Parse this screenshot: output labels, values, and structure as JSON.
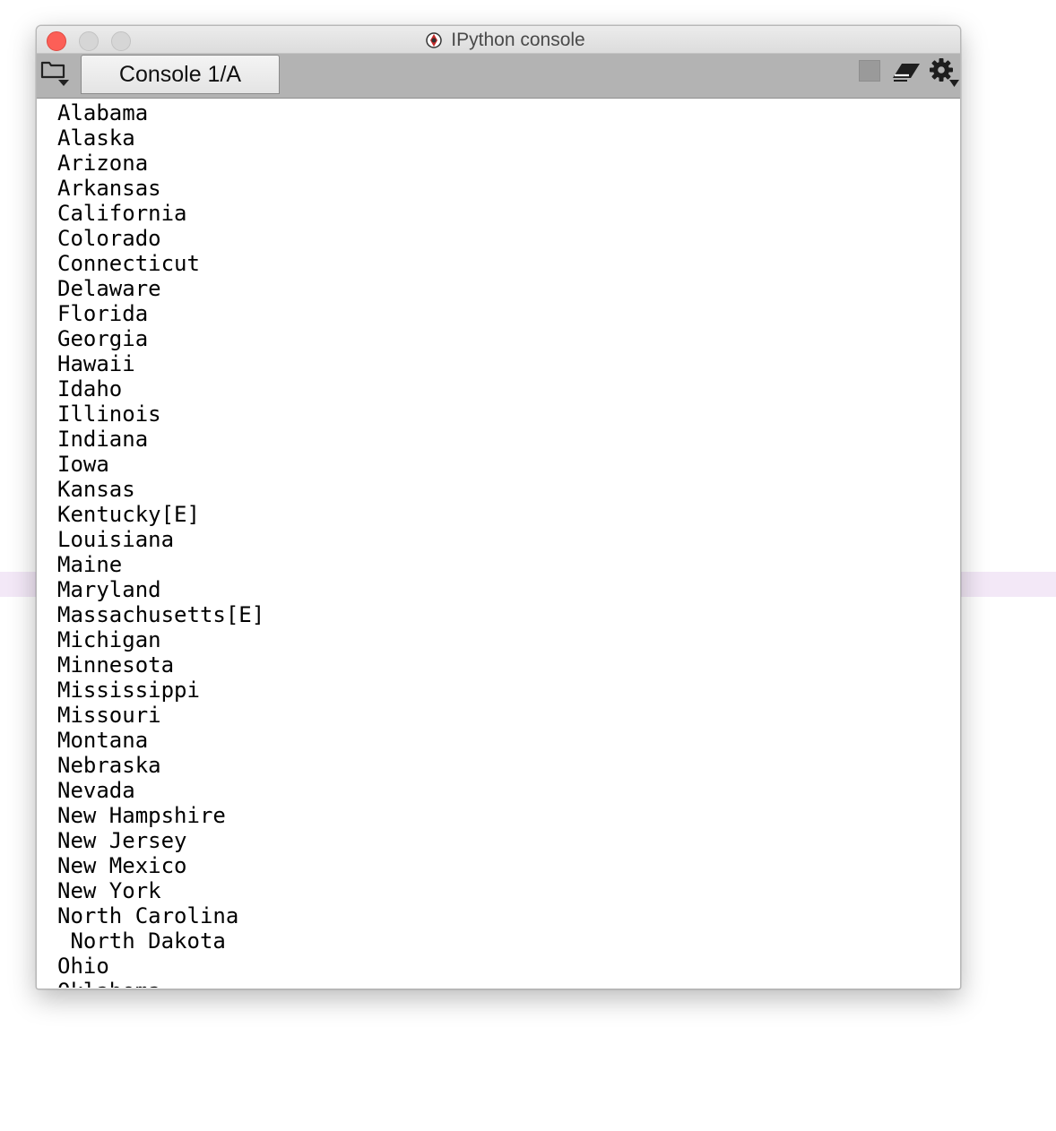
{
  "window": {
    "title": "IPython console"
  },
  "toolbar": {
    "tab_label": "Console 1/A"
  },
  "console": {
    "lines": [
      "Alabama",
      "Alaska",
      "Arizona",
      "Arkansas",
      "California",
      "Colorado",
      "Connecticut",
      "Delaware",
      "Florida",
      "Georgia",
      "Hawaii",
      "Idaho",
      "Illinois",
      "Indiana",
      "Iowa",
      "Kansas",
      "Kentucky[E]",
      "Louisiana",
      "Maine",
      "Maryland",
      "Massachusetts[E]",
      "Michigan",
      "Minnesota",
      "Mississippi",
      "Missouri",
      "Montana",
      "Nebraska",
      "Nevada",
      "New Hampshire",
      "New Jersey",
      "New Mexico",
      "New York",
      "North Carolina",
      " North Dakota",
      "Ohio",
      "Oklahoma"
    ]
  },
  "icons": {
    "close": "close-traffic-light",
    "minimize": "minimize-traffic-light",
    "maximize": "maximize-traffic-light",
    "app": "spyder-icon",
    "browse": "folder-icon",
    "stop": "stop-icon",
    "clear": "eraser-icon",
    "options": "gear-icon"
  },
  "colors": {
    "close_button": "#fc5f57",
    "toolbar_bg": "#b3b3b3",
    "console_bg": "#ffffff",
    "console_text": "#000000"
  }
}
